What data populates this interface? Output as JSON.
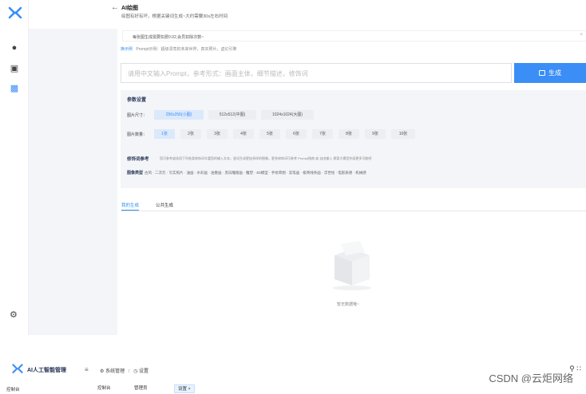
{
  "header": {
    "title": "AI绘图",
    "subtitle": "绘图有好有坏，根据关键词生成~大约需要30s左右时间"
  },
  "notice": {
    "text": "每张图生成需要扣费0.02,会员扣除次数~",
    "close": "×"
  },
  "examples": {
    "link_label": "换示例",
    "prompt_hint": "Prompt示例：超级漂亮的未来世界，真实照片，虚幻引擎"
  },
  "prompt": {
    "placeholder": "请用中文输入Prompt，参考形式：画面主体，细节描述，修饰词"
  },
  "generate": {
    "label": "生成"
  },
  "params": {
    "title": "参数设置",
    "size_label": "图片尺寸：",
    "sizes": [
      "256x256(小图)",
      "512x512(中图)",
      "1024x1024(大图)"
    ],
    "count_label": "图片数量：",
    "counts": [
      "1张",
      "2张",
      "3张",
      "4张",
      "5张",
      "6张",
      "7张",
      "8张",
      "9张",
      "10张"
    ],
    "modifier_title": "修饰词参考",
    "modifier_desc": "您可参考或选用下列各类修饰词丰富您的输入文本，尝试生成更加多样的图像，更多修饰词可参考 Prompt指南 或 自由输入 探索大模型作画更多可能吧",
    "style_label": "图像类型",
    "styles": [
      "古风",
      "二次元",
      "写实照片",
      "油画",
      "水彩画",
      "油墨画",
      "黑白雕版画",
      "雕塑",
      "3D模型",
      "手绘草图",
      "炭笔画",
      "极简线条画",
      "浮世绘",
      "电影质感",
      "机械感"
    ]
  },
  "tabs": [
    "我的生成",
    "公共生成"
  ],
  "empty": {
    "text": "暂无数据哦~"
  },
  "bottom": {
    "brand": "AI人工智能管理",
    "breadcrumb": [
      "系统管理",
      "设置"
    ],
    "nav_home": "控制台",
    "tags": [
      "控制台",
      "管理员",
      "设置"
    ],
    "tag_close": "×",
    "watermark": "CSDN @云炬网络"
  },
  "colors": {
    "accent": "#3a8ef6",
    "panel_bg": "#f4f5f8",
    "brand_dark": "#1f2d50"
  },
  "icons": {
    "rail": [
      "app-logo-icon",
      "robot-icon",
      "chat-icon",
      "image-icon",
      "settings-icon"
    ],
    "bottom": [
      "menu-fold-icon",
      "gear-icon",
      "search-icon",
      "grid-icon"
    ]
  }
}
